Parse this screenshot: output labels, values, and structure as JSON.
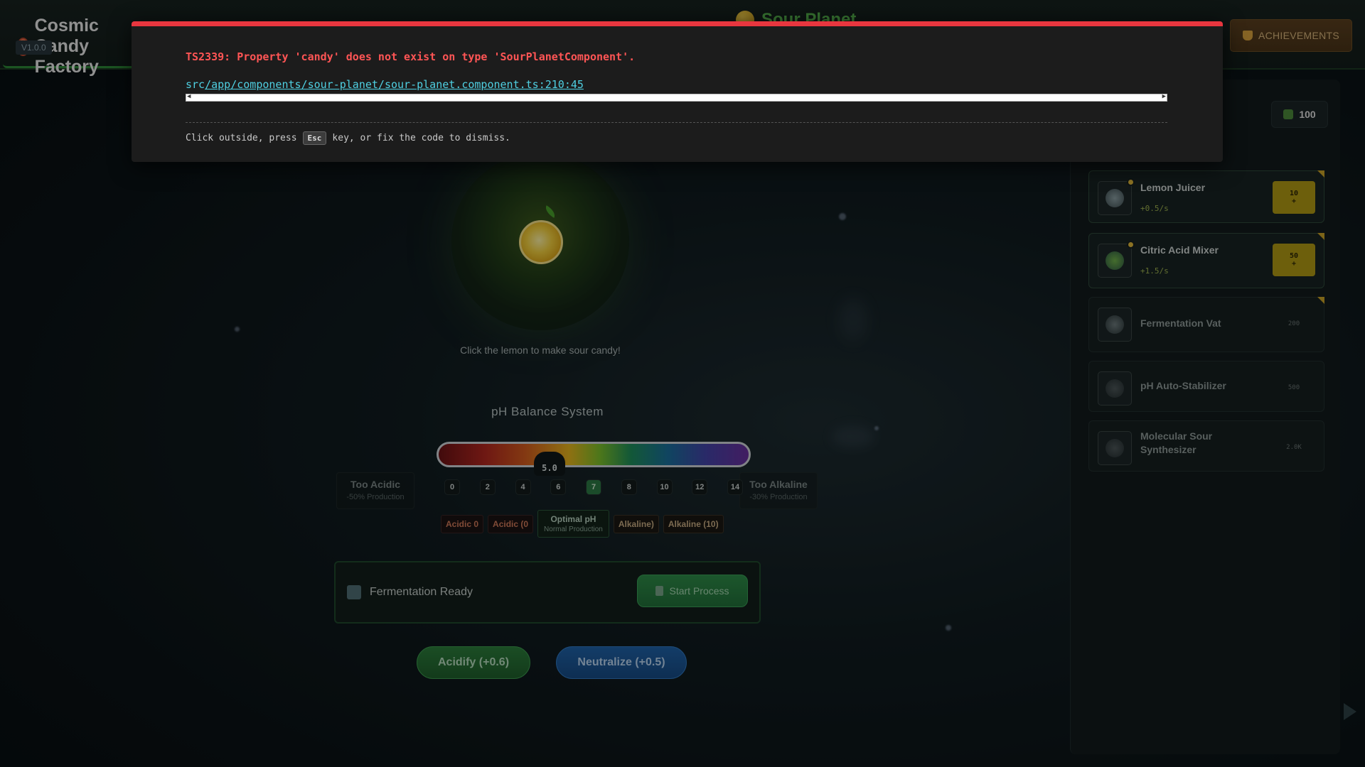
{
  "app": {
    "title": "Cosmic Candy Factory",
    "version": "V1.0.0"
  },
  "planet": {
    "name": "Sour Planet"
  },
  "header": {
    "achievements_label": "ACHIEVEMENTS"
  },
  "sidebar": {
    "currency": "100",
    "upgrades": [
      {
        "name": "Lemon Juicer",
        "rate": "+0.5/s",
        "cost": "10",
        "cost_suffix": "+"
      },
      {
        "name": "Citric Acid Mixer",
        "rate": "+1.5/s",
        "cost": "50",
        "cost_suffix": "+"
      },
      {
        "name": "Fermentation Vat",
        "rate": "",
        "cost": "200",
        "cost_suffix": ""
      },
      {
        "name": "pH Auto-Stabilizer",
        "rate": "",
        "cost": "500",
        "cost_suffix": ""
      },
      {
        "name": "Molecular Sour Synthesizer",
        "rate": "",
        "cost": "2.0K",
        "cost_suffix": ""
      }
    ]
  },
  "main": {
    "click_hint": "Click the lemon to make sour candy!",
    "ph": {
      "title": "pH Balance System",
      "current": "5.0",
      "scale": [
        "0",
        "2",
        "4",
        "6",
        "7",
        "8",
        "10",
        "12",
        "14"
      ],
      "too_acidic": {
        "title": "Too Acidic",
        "sub": "-50% Production"
      },
      "too_alkaline": {
        "title": "Too Alkaline",
        "sub": "-30% Production"
      },
      "zones": {
        "acidic_a": "Acidic 0",
        "acidic_b": "Acidic (0",
        "optimal_title": "Optimal pH",
        "optimal_sub": "Normal Production",
        "alkaline_a": "Alkaline)",
        "alkaline_b": "Alkaline (10)"
      }
    },
    "fermentation": {
      "status": "Fermentation Ready",
      "button": "Start Process"
    },
    "actions": {
      "acidify": "Acidify (+0.6)",
      "neutralize": "Neutralize (+0.5)"
    }
  },
  "error_overlay": {
    "message": "TS2339: Property 'candy' does not exist on type 'SourPlanetComponent'.",
    "file_prefix": "src",
    "file_path": "/app/components/sour-planet/sour-planet.component.ts:210:45",
    "dismiss_before": "Click outside, press",
    "dismiss_key": "Esc",
    "dismiss_after": "key, or fix the code to dismiss."
  },
  "colors": {
    "accent_green": "#2e8a37",
    "error_red": "#e8363f",
    "link_cyan": "#4fd0e2"
  }
}
